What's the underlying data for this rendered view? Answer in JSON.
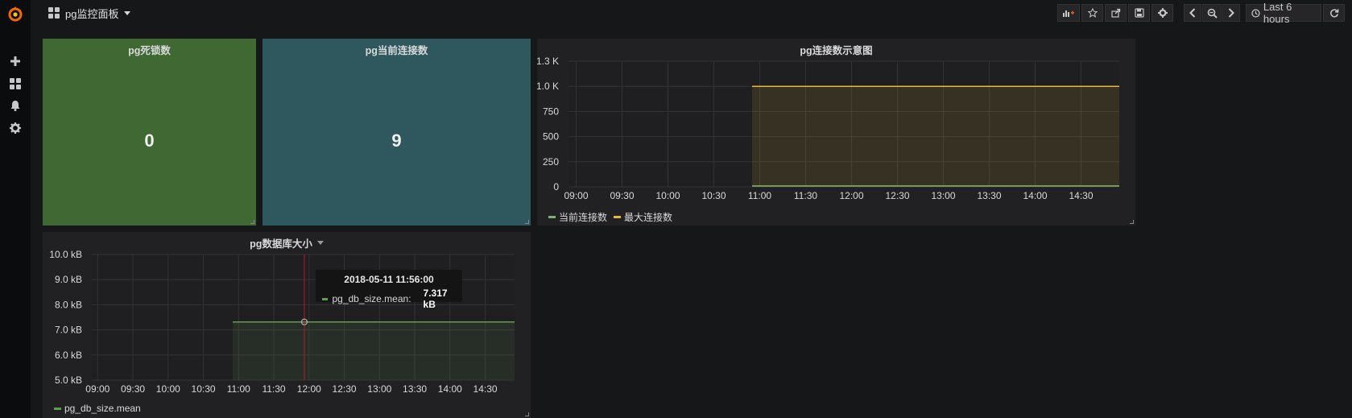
{
  "topbar": {
    "dashboard_title": "pg监控面板",
    "time_range_label": "Last 6 hours"
  },
  "icons": {
    "add": "plus-icon",
    "dashboards": "dashboards-icon",
    "alerts": "bell-icon",
    "settings": "gear-icon"
  },
  "colors": {
    "stat_green": "#3f6833",
    "stat_teal": "#2f575e",
    "series_green": "#7eb26d",
    "series_yellow": "#eab839",
    "series_green_alt": "#629e51"
  },
  "panels": {
    "deadlocks": {
      "title": "pg死锁数",
      "value": "0"
    },
    "connections": {
      "title": "pg当前连接数",
      "value": "9"
    },
    "conn_graph": {
      "title": "pg连接数示意图"
    },
    "db_size": {
      "title": "pg数据库大小"
    }
  },
  "tooltip": {
    "time": "2018-05-11 11:56:00",
    "series": "pg_db_size.mean:",
    "value": "7.317 kB"
  },
  "chart_data": [
    {
      "type": "area",
      "title": "pg连接数示意图",
      "x_ticks": [
        "09:00",
        "09:30",
        "10:00",
        "10:30",
        "11:00",
        "11:30",
        "12:00",
        "12:30",
        "13:00",
        "13:30",
        "14:00",
        "14:30"
      ],
      "y_ticks": [
        "0",
        "250",
        "500",
        "750",
        "1.0 K",
        "1.3 K"
      ],
      "ylim": [
        0,
        1250
      ],
      "xlim": [
        "08:55",
        "14:55"
      ],
      "legend": "bottom-left",
      "series": [
        {
          "name": "当前连接数",
          "color": "#7eb26d",
          "x": [
            "10:55",
            "14:55"
          ],
          "values": [
            9,
            9
          ]
        },
        {
          "name": "最大连接数",
          "color": "#eab839",
          "x": [
            "10:55",
            "14:55"
          ],
          "values": [
            1000,
            1000
          ]
        }
      ]
    },
    {
      "type": "area",
      "title": "pg数据库大小",
      "x_ticks": [
        "09:00",
        "09:30",
        "10:00",
        "10:30",
        "11:00",
        "11:30",
        "12:00",
        "12:30",
        "13:00",
        "13:30",
        "14:00",
        "14:30"
      ],
      "y_ticks": [
        "5.0 kB",
        "6.0 kB",
        "7.0 kB",
        "8.0 kB",
        "9.0 kB",
        "10.0 kB"
      ],
      "ylim": [
        5.0,
        10.0
      ],
      "xlim": [
        "08:55",
        "14:55"
      ],
      "legend": "bottom-left",
      "series": [
        {
          "name": "pg_db_size.mean",
          "color": "#629e51",
          "x": [
            "10:55",
            "14:55"
          ],
          "values": [
            7.317,
            7.317
          ]
        }
      ],
      "hover": {
        "x": "11:56",
        "y": 7.317
      }
    }
  ]
}
